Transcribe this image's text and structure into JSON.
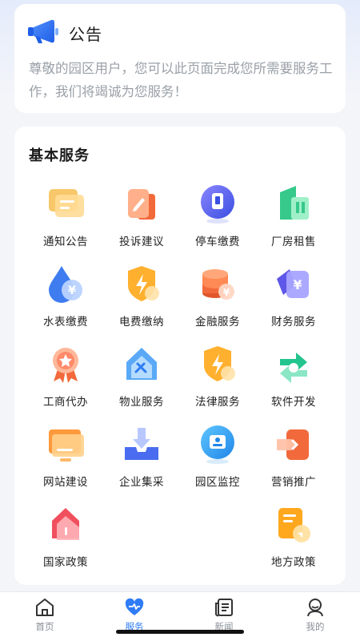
{
  "notice": {
    "title": "公告",
    "icon": "megaphone-icon",
    "text": "尊敬的园区用户，您可以此页面完成您所需要服务工作，我们将竭诚为您服务！"
  },
  "services": {
    "title": "基本服务",
    "items": [
      {
        "label": "通知公告",
        "icon": "notification-icon"
      },
      {
        "label": "投诉建议",
        "icon": "complaint-icon"
      },
      {
        "label": "停车缴费",
        "icon": "parking-icon"
      },
      {
        "label": "厂房租售",
        "icon": "factory-icon"
      },
      {
        "label": "水表缴费",
        "icon": "water-meter-icon"
      },
      {
        "label": "电费缴纳",
        "icon": "electricity-icon"
      },
      {
        "label": "金融服务",
        "icon": "finance-icon"
      },
      {
        "label": "财务服务",
        "icon": "accounting-icon"
      },
      {
        "label": "工商代办",
        "icon": "business-license-icon"
      },
      {
        "label": "物业服务",
        "icon": "property-icon"
      },
      {
        "label": "法律服务",
        "icon": "legal-icon"
      },
      {
        "label": "软件开发",
        "icon": "software-icon"
      },
      {
        "label": "网站建设",
        "icon": "website-icon"
      },
      {
        "label": "企业集采",
        "icon": "procurement-icon"
      },
      {
        "label": "园区监控",
        "icon": "monitoring-icon"
      },
      {
        "label": "营销推广",
        "icon": "marketing-icon"
      },
      {
        "label": "国家政策",
        "icon": "national-policy-icon"
      },
      {
        "label": "地方政策",
        "icon": "local-policy-icon"
      }
    ]
  },
  "tabbar": {
    "items": [
      {
        "label": "首页",
        "icon": "home-icon"
      },
      {
        "label": "服务",
        "icon": "service-heart-icon",
        "active": true
      },
      {
        "label": "新闻",
        "icon": "news-icon"
      },
      {
        "label": "我的",
        "icon": "profile-icon"
      }
    ]
  },
  "colors": {
    "accent": "#2f7cf6",
    "background": "#f3f5f9",
    "muted_text": "#9aa0a8"
  }
}
